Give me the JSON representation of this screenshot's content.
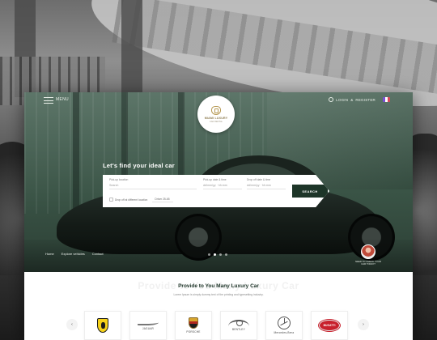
{
  "topbar": {
    "menu_label": "MENU",
    "login_label": "LOGIN",
    "separator": "&",
    "register_label": "REGISTER"
  },
  "logo": {
    "name": "MIAMI LUXURY",
    "tagline": "CAR RENTAL"
  },
  "hero": {
    "title": "Let's find your ideal car",
    "nav": [
      "Home",
      "Explore vehicles",
      "Contact"
    ],
    "slides": 4,
    "active_slide": 1,
    "agent_text": "NEED TO CHECK YOUR CAR TODAY?"
  },
  "search": {
    "pickup_label": "Pick-up location",
    "pickup_placeholder": "Search",
    "pickup_date_label": "Pick-up date & time",
    "pickup_date_placeholder": "dd/mm/yy · hh:mm",
    "return_date_label": "Drop off date & time",
    "return_date_placeholder": "dd/mm/yy · hh:mm",
    "different_location_label": "Drop off at different location",
    "driver_age_label": "Driver 25-65",
    "search_button": "SEARCH"
  },
  "brands": {
    "watermark": "Provide to You Many Luxury Car",
    "title": "Provide to You Many Luxury Car",
    "description": "Lorem Ipsum is simply dummy text of the printing and typesetting industry.",
    "prev": "‹",
    "next": "›",
    "items": [
      {
        "name": "",
        "icon": "ferrari-logo"
      },
      {
        "name": "JAGUAR",
        "icon": "jaguar-logo"
      },
      {
        "name": "PORSCHE",
        "icon": "porsche-logo"
      },
      {
        "name": "BENTLEY",
        "icon": "bentley-logo"
      },
      {
        "name": "Mercedes-Benz",
        "icon": "mercedes-logo"
      },
      {
        "name": "BUGATTI",
        "icon": "bugatti-logo"
      }
    ]
  },
  "colors": {
    "accent": "#1d3528",
    "hero_tint": "#3a5446",
    "logo_gold": "#b79a55"
  }
}
